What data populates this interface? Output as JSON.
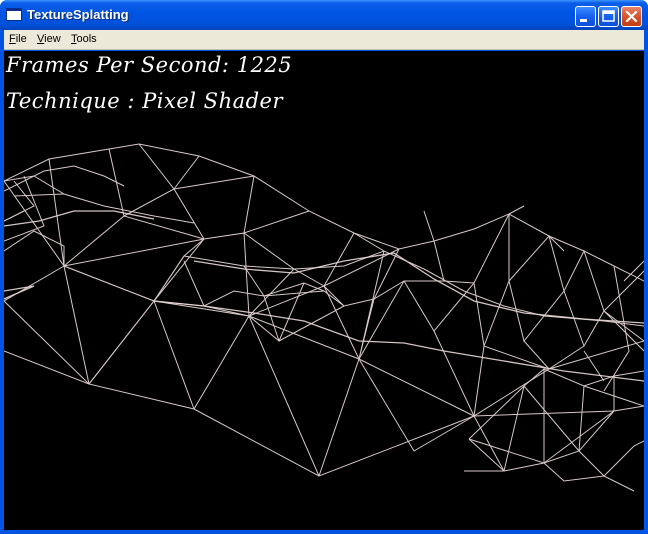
{
  "window": {
    "title": "TextureSplatting",
    "app_icon": "window-icon",
    "controls": [
      "minimize-icon",
      "maximize-icon",
      "close-icon"
    ]
  },
  "menu": {
    "file": "File",
    "view": "View",
    "tools": "Tools"
  },
  "overlay": {
    "fps_label": "Frames Per Second:",
    "fps_value": "1225",
    "technique_label": "Technique :",
    "technique_value": "Pixel Shader"
  },
  "colors": {
    "titlebar": "#0054e3",
    "menubar": "#ece9d8",
    "viewport": "#000000",
    "wireframe": "#d8c8c8",
    "overlay_text": "#ffffff"
  }
}
